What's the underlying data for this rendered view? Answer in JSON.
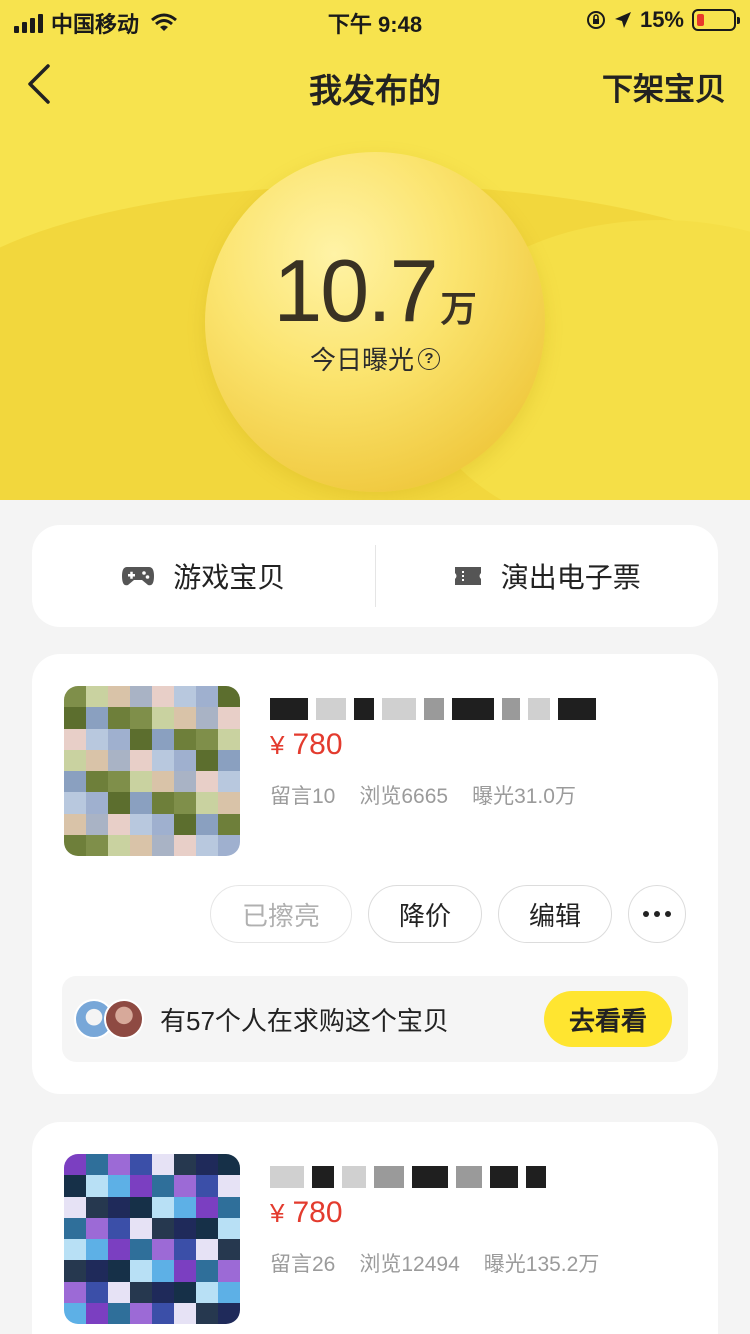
{
  "status_bar": {
    "carrier": "中国移动",
    "time": "下午 9:48",
    "battery_percent": "15%"
  },
  "nav": {
    "title": "我发布的",
    "right_action": "下架宝贝"
  },
  "exposure": {
    "value": "10.7",
    "unit": "万",
    "label": "今日曝光",
    "help_symbol": "?"
  },
  "tabs": [
    {
      "label": "游戏宝贝",
      "icon": "gamepad-icon"
    },
    {
      "label": "演出电子票",
      "icon": "ticket-icon"
    }
  ],
  "items": [
    {
      "price_symbol": "¥",
      "price": "780",
      "comments": "留言10",
      "views": "浏览6665",
      "exposure": "曝光31.0万",
      "actions": {
        "polish": "已擦亮",
        "reduce_price": "降价",
        "edit": "编辑"
      },
      "demand": {
        "text": "有57个人在求购这个宝贝",
        "button": "去看看"
      }
    },
    {
      "price_symbol": "¥",
      "price": "780",
      "comments": "留言26",
      "views": "浏览12494",
      "exposure": "曝光135.2万"
    }
  ],
  "colors": {
    "header_yellow": "#f7e34e",
    "price_red": "#e33b2e",
    "cta_yellow": "#ffe530"
  }
}
